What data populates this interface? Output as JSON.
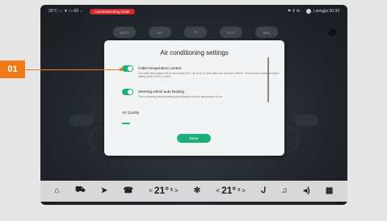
{
  "status_bar": {
    "left": "25°C  ↑↓ ▼  ▭ 69  ⇔",
    "alert": "Commissioning mode",
    "right": "⚑  ⚲  ✉",
    "user": "Lixingjie  00:39"
  },
  "top_controls": [
    "AUTO",
    "A/C",
    "⦿",
    "ECO",
    "MAX"
  ],
  "modal": {
    "title": "Air conditioning settings",
    "items": [
      {
        "title": "Cabin temperature control",
        "desc": "The cabin temperature will be kept below 40°C for up to 24 hours after you leave the vehicle. This function is disabled when battery level is 20% or lower.",
        "on": true
      },
      {
        "title": "Steering wheel auto heating",
        "desc": "Turn on steering wheel heating automatically when the temperature is low",
        "on": true
      }
    ],
    "air_quality_label": "Air Quality",
    "done_label": "Done"
  },
  "callout": {
    "label": "01",
    "color": "#f07a19"
  },
  "dock": {
    "icons": [
      "home-icon",
      "car-icon",
      "navigation-icon",
      "phone-icon",
      "fan-icon",
      "seat-heat-icon",
      "music-icon",
      "volume-icon",
      "apps-icon"
    ],
    "temp_left": "21°",
    "temp_left_sub": "5",
    "temp_right": "21°",
    "temp_right_sub": "0",
    "prev": "<",
    "next": ">"
  },
  "colors": {
    "accent": "#1bb07a",
    "alert": "#d8282f"
  }
}
